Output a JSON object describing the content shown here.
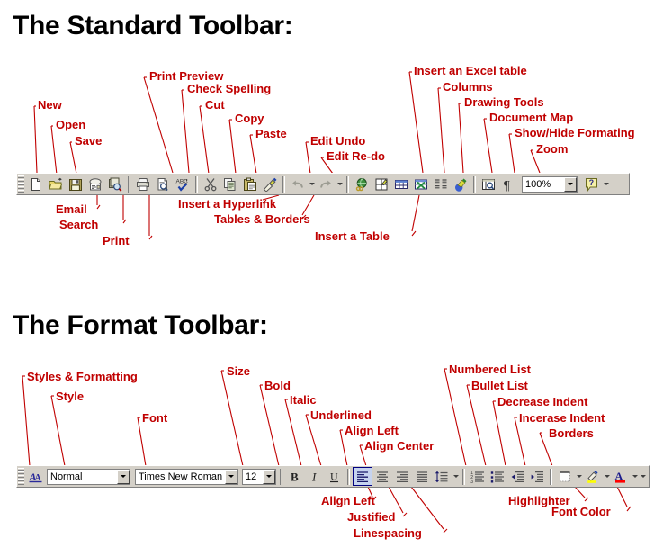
{
  "headings": {
    "standard": "The Standard Toolbar:",
    "format": "The Format Toolbar:"
  },
  "colors": {
    "annotation": "#c00000",
    "toolbar_face": "#d4d0c8",
    "heading": "#000000",
    "highlight_yellow": "#ffff00",
    "font_color_red": "#ff0000",
    "pressed_border": "#000080"
  },
  "standard_toolbar": {
    "labels_above": [
      "New",
      "Open",
      "Save",
      "Print Preview",
      "Check Spelling",
      "Cut",
      "Copy",
      "Paste",
      "Edit Undo",
      "Edit Re-do",
      "Insert an Excel table",
      "Columns",
      "Drawing Tools",
      "Document Map",
      "Show/Hide Formating",
      "Zoom"
    ],
    "labels_below": [
      "Email",
      "Search",
      "Print",
      "Insert a Hyperlink",
      "Tables & Borders",
      "Insert a Table"
    ],
    "buttons": [
      {
        "name": "new-document",
        "icon": "new-document-icon"
      },
      {
        "name": "open",
        "icon": "open-folder-icon"
      },
      {
        "name": "save",
        "icon": "save-disk-icon"
      },
      {
        "name": "email",
        "icon": "email-icon"
      },
      {
        "name": "search",
        "icon": "search-icon"
      },
      {
        "name": "print",
        "icon": "print-icon"
      },
      {
        "name": "print-preview",
        "icon": "print-preview-icon"
      },
      {
        "name": "spelling",
        "icon": "spell-check-icon"
      },
      {
        "name": "cut",
        "icon": "scissors-icon"
      },
      {
        "name": "copy",
        "icon": "copy-icon"
      },
      {
        "name": "paste",
        "icon": "paste-icon"
      },
      {
        "name": "format-painter",
        "icon": "format-painter-icon"
      },
      {
        "name": "undo",
        "icon": "undo-icon"
      },
      {
        "name": "redo",
        "icon": "redo-icon"
      },
      {
        "name": "hyperlink",
        "icon": "hyperlink-globe-icon"
      },
      {
        "name": "tables-and-borders",
        "icon": "tables-borders-icon"
      },
      {
        "name": "insert-table",
        "icon": "insert-table-icon"
      },
      {
        "name": "insert-excel-table",
        "icon": "excel-table-icon"
      },
      {
        "name": "columns",
        "icon": "columns-icon"
      },
      {
        "name": "drawing",
        "icon": "drawing-tools-icon"
      },
      {
        "name": "document-map",
        "icon": "document-map-icon"
      },
      {
        "name": "show-hide-formatting",
        "icon": "pilcrow-icon"
      },
      {
        "name": "help",
        "icon": "help-question-icon"
      }
    ],
    "zoom_value": "100%"
  },
  "format_toolbar": {
    "labels_above": [
      "Styles & Formatting",
      "Style",
      "Font",
      "Size",
      "Bold",
      "Italic",
      "Underlined",
      "Align Left",
      "Align Center",
      "Numbered List",
      "Bullet List",
      "Decrease Indent",
      "Incerase Indent",
      "Borders"
    ],
    "labels_below": [
      "Align Left",
      "Justified",
      "Linespacing",
      "Highlighter",
      "Font Color"
    ],
    "style_value": "Normal",
    "font_value": "Times New Roman",
    "size_value": "12",
    "buttons": [
      {
        "name": "styles-and-formatting",
        "icon": "styles-formatting-icon"
      },
      {
        "name": "bold",
        "icon": "bold-icon",
        "label": "B"
      },
      {
        "name": "italic",
        "icon": "italic-icon",
        "label": "I"
      },
      {
        "name": "underline",
        "icon": "underline-icon",
        "label": "U"
      },
      {
        "name": "align-left",
        "icon": "align-left-icon"
      },
      {
        "name": "align-center",
        "icon": "align-center-icon"
      },
      {
        "name": "align-right",
        "icon": "align-right-icon"
      },
      {
        "name": "justify",
        "icon": "align-justify-icon"
      },
      {
        "name": "line-spacing",
        "icon": "line-spacing-icon"
      },
      {
        "name": "numbered-list",
        "icon": "numbered-list-icon"
      },
      {
        "name": "bullet-list",
        "icon": "bullet-list-icon"
      },
      {
        "name": "decrease-indent",
        "icon": "decrease-indent-icon"
      },
      {
        "name": "increase-indent",
        "icon": "increase-indent-icon"
      },
      {
        "name": "borders",
        "icon": "borders-icon"
      },
      {
        "name": "highlight",
        "icon": "highlighter-icon"
      },
      {
        "name": "font-color",
        "icon": "font-color-icon"
      }
    ]
  }
}
